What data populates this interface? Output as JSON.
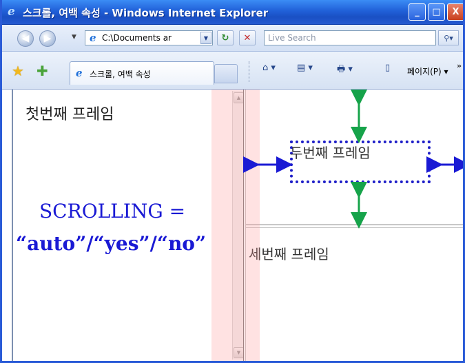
{
  "window": {
    "title": "스크롤, 여백 속성 - Windows Internet Explorer",
    "minimize_label": "_",
    "maximize_label": "□",
    "close_label": "X"
  },
  "addressbar": {
    "back_label": "◀",
    "forward_label": "▶",
    "dropdown_arrow": "▼",
    "address_value": "C:\\Documents ar",
    "refresh_label": "↻",
    "stop_label": "✕",
    "search_placeholder": "Live Search",
    "search_button": "⚲▾"
  },
  "tabbar": {
    "tab_label": "스크롤, 여백 속성",
    "home_label": "⌂ ▾",
    "feeds_label": "▤ ▾",
    "print_label": "🖶 ▾",
    "page_label": "페이지(P) ▾",
    "more_label": "»"
  },
  "frames": {
    "frame1_title": "첫번째 프레임",
    "frame2_title": "두번째 프레임",
    "frame3_title": "세번째 프레임",
    "scroll_up": "▲",
    "scroll_down": "▼"
  },
  "annotation": {
    "line1": "SCROLLING =",
    "line2": "“auto”/“yes”/“no”"
  },
  "colors": {
    "annotation_text": "#1a1ad4",
    "horizontal_arrow": "#1a1ad4",
    "vertical_arrow": "#16a34a",
    "highlight": "#ff9696"
  }
}
